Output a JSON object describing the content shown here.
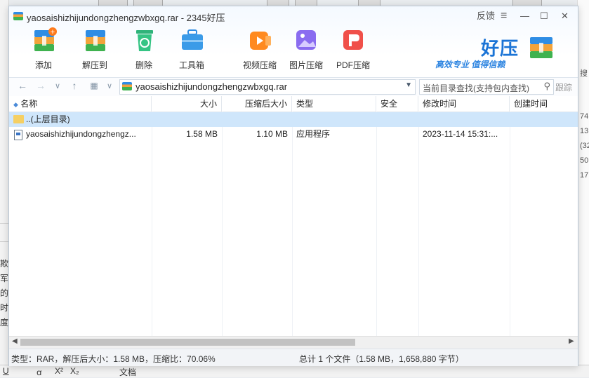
{
  "window": {
    "title": "yaosaishizhijundongzhengzwbxgq.rar - 2345好压",
    "feedback": "反馈",
    "menu_icon": "≡",
    "minimize_icon": "—",
    "maximize_icon": "☐",
    "close_icon": "✕"
  },
  "toolbar": {
    "add": "添加",
    "extract": "解压到",
    "delete": "删除",
    "tools": "工具箱",
    "video": "视频压缩",
    "image": "图片压缩",
    "pdf": "PDF压缩"
  },
  "logo": {
    "name": "好压",
    "slogan": "高效专业  值得信赖"
  },
  "address": {
    "path": "yaosaishizhijundongzhengzwbxgq.rar",
    "search_placeholder": "当前目录查找(支持包内查找)",
    "search_button": "跟踪"
  },
  "columns": {
    "name": "名称",
    "size": "大小",
    "packed": "压缩后大小",
    "type": "类型",
    "security": "安全",
    "modified": "修改时间",
    "created": "创建时间"
  },
  "rows": [
    {
      "name": "..(上层目录)"
    },
    {
      "name": "yaosaishizhijundongzhengz...",
      "size": "1.58 MB",
      "packed": "1.10 MB",
      "type": "应用程序",
      "modified": "2023-11-14 15:31:..."
    }
  ],
  "status": {
    "left": "类型：RAR，解压后大小：1.58 MB，压缩比：70.06%",
    "right": "总计 1 个文件（1.58 MB，1,658,880 字节）"
  },
  "background": {
    "left_chars": [
      "欺",
      "军",
      "的",
      "时",
      "度"
    ],
    "right_chars": [
      "搜",
      "74",
      "13",
      "(32",
      "50",
      "17"
    ],
    "bottom_items": [
      "U",
      "ꭤ",
      "X²",
      "X₂",
      "文档"
    ]
  },
  "colors": {
    "accent": "#1b74d6",
    "selection": "#cfe6fb"
  }
}
